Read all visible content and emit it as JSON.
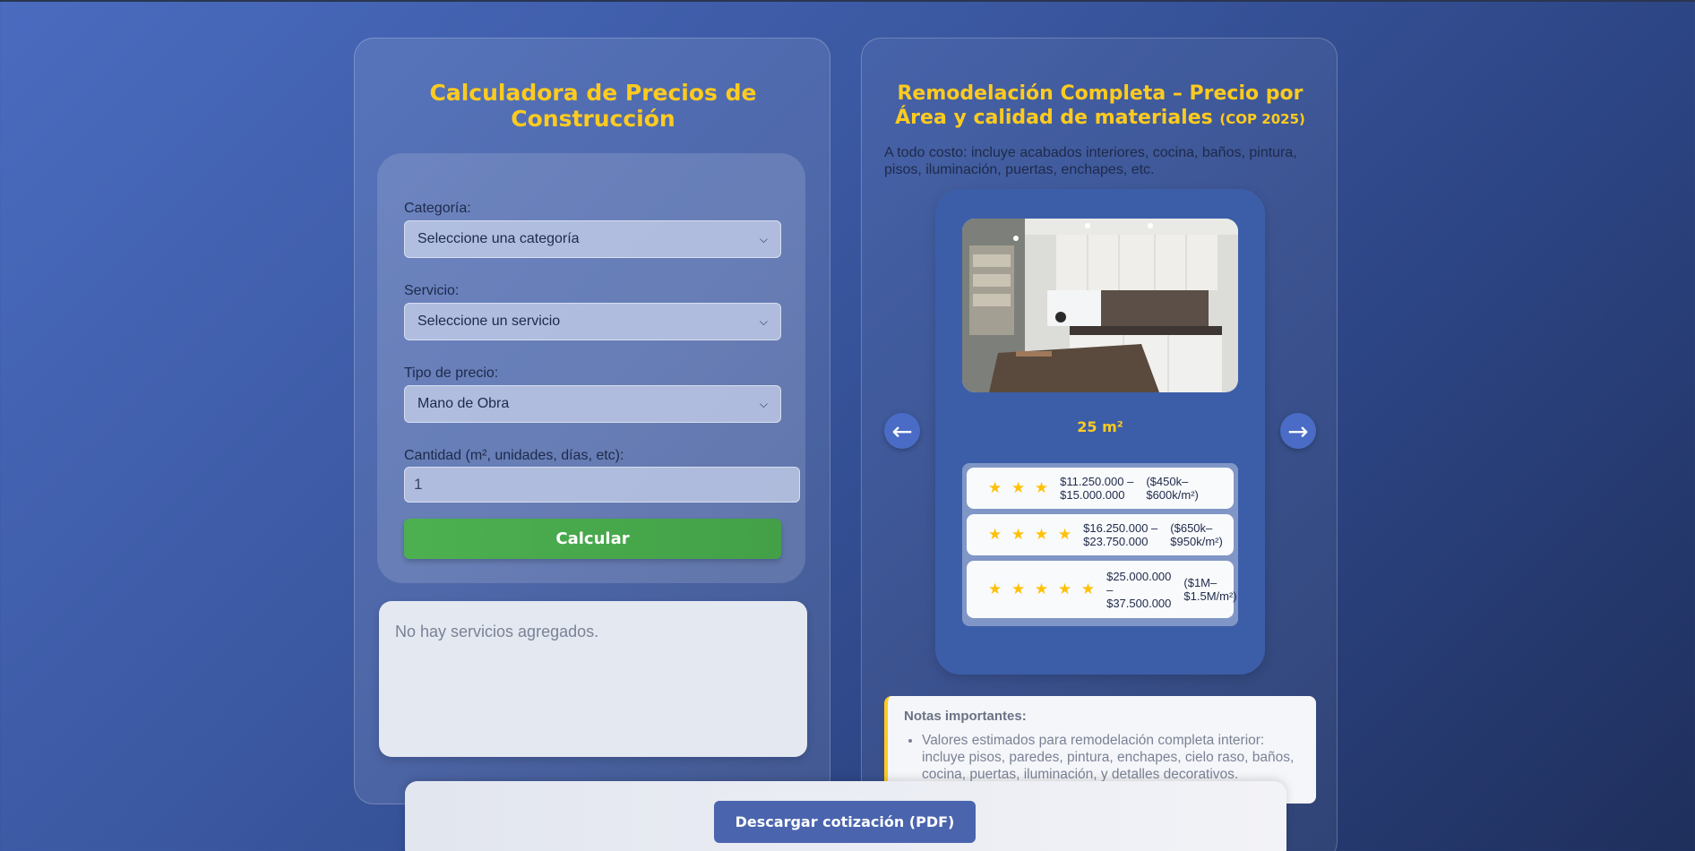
{
  "calculator": {
    "title": "Calculadora de Precios de Construcción",
    "fields": {
      "category_label": "Categoría:",
      "category_value": "Seleccione una categoría",
      "service_label": "Servicio:",
      "service_value": "Seleccione un servicio",
      "price_type_label": "Tipo de precio:",
      "price_type_value": "Mano de Obra",
      "quantity_label": "Cantidad (m², unidades, días, etc):",
      "quantity_value": "1"
    },
    "calculate_button": "Calcular",
    "services_empty": "No hay servicios agregados."
  },
  "remodel": {
    "title": "Remodelación Completa – Precio por Área y calidad de materiales",
    "title_small": "(COP 2025)",
    "description": "A todo costo: incluye acabados interiores, cocina, baños, pintura, pisos, iluminación, puertas, enchapes, etc.",
    "area": "25 m²",
    "prev_arrow": "←",
    "next_arrow": "→",
    "tiers": [
      {
        "stars": "★ ★ ★",
        "price_line1": "$11.250.000 –",
        "price_line2": "$15.000.000",
        "rate_line1": "($450k–",
        "rate_line2": "$600k/m²)",
        "rating": 3
      },
      {
        "stars": "★ ★ ★ ★",
        "price_line1": "$16.250.000 –",
        "price_line2": "$23.750.000",
        "rate_line1": "($650k–",
        "rate_line2": "$950k/m²)",
        "rating": 4
      },
      {
        "stars": "★ ★ ★ ★ ★",
        "price_line1": "$25.000.000",
        "price_line2": "–",
        "price_line3": "$37.500.000",
        "rate_line1": "($1M–",
        "rate_line2": "$1.5M/m²)",
        "rating": 5
      }
    ],
    "notes_title": "Notas importantes:",
    "notes": [
      "Valores estimados para remodelación completa interior: incluye pisos, paredes, pintura, enchapes, cielo raso, baños, cocina, puertas, iluminación, y detalles decorativos."
    ]
  },
  "footer": {
    "pdf_button": "Descargar cotización (PDF)"
  },
  "colors": {
    "accent_yellow": "#ffcb1f",
    "button_green": "#4cb050",
    "button_blue": "#4a64ae",
    "star": "#ffc107"
  }
}
